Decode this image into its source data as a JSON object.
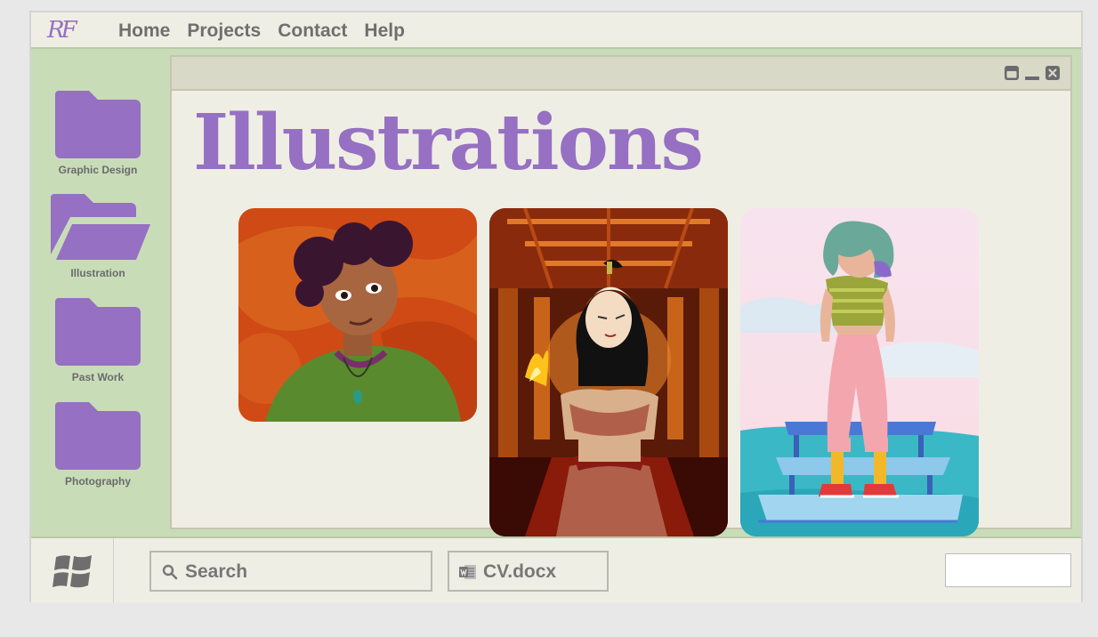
{
  "brand": {
    "logo_text": "RF"
  },
  "nav": {
    "items": [
      {
        "label": "Home"
      },
      {
        "label": "Projects"
      },
      {
        "label": "Contact"
      },
      {
        "label": "Help"
      }
    ]
  },
  "sidebar": {
    "folders": [
      {
        "label": "Graphic Design",
        "state": "closed"
      },
      {
        "label": "Illustration",
        "state": "open"
      },
      {
        "label": "Past Work",
        "state": "closed"
      },
      {
        "label": "Photography",
        "state": "closed"
      }
    ]
  },
  "window": {
    "heading": "Illustrations",
    "controls": [
      "maximize-icon",
      "minimize-icon",
      "close-icon"
    ],
    "gallery": [
      {
        "subject": "girl in green shirt on orange background"
      },
      {
        "subject": "fire-bending warrior in palace hall"
      },
      {
        "subject": "teal-haired girl standing on blue benches"
      }
    ]
  },
  "taskbar": {
    "start_icon": "windows-logo-icon",
    "search_label": "Search",
    "open_file_label": "CV.docx"
  },
  "colors": {
    "accent": "#9670c2",
    "frame": "#c9dcb8",
    "panel": "#efeee4",
    "text": "#6f6f6f"
  }
}
